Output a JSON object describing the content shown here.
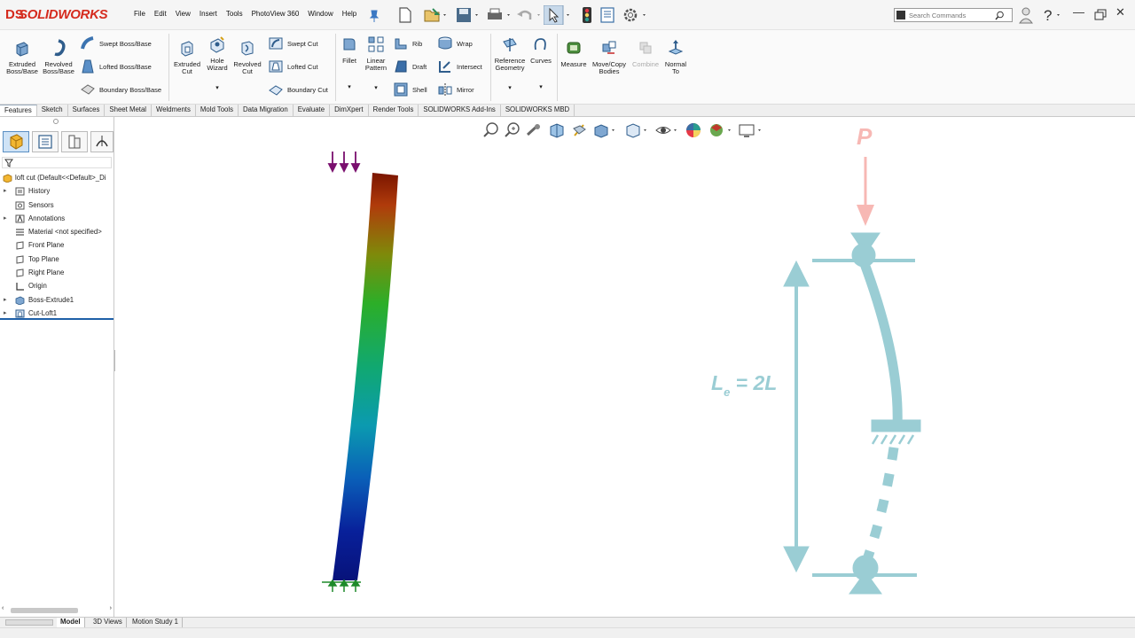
{
  "app": {
    "logo_ds": "DS",
    "logo_name": "SOLIDWORKS",
    "menu": [
      "File",
      "Edit",
      "View",
      "Insert",
      "Tools",
      "PhotoView 360",
      "Window",
      "Help"
    ],
    "search_placeholder": "Search Commands"
  },
  "ribbon": {
    "extruded_boss": "Extruded Boss/Base",
    "revolved_boss": "Revolved Boss/Base",
    "swept_boss": "Swept Boss/Base",
    "lofted_boss": "Lofted Boss/Base",
    "boundary_boss": "Boundary Boss/Base",
    "extruded_cut": "Extruded Cut",
    "hole_wizard": "Hole Wizard",
    "revolved_cut": "Revolved Cut",
    "swept_cut": "Swept Cut",
    "lofted_cut": "Lofted Cut",
    "boundary_cut": "Boundary Cut",
    "fillet": "Fillet",
    "linear_pattern": "Linear Pattern",
    "rib": "Rib",
    "draft": "Draft",
    "shell": "Shell",
    "wrap": "Wrap",
    "intersect": "Intersect",
    "mirror": "Mirror",
    "reference_geometry": "Reference Geometry",
    "curves": "Curves",
    "measure": "Measure",
    "move_copy": "Move/Copy Bodies",
    "combine": "Combine",
    "normal_to": "Normal To"
  },
  "tabs": [
    "Features",
    "Sketch",
    "Surfaces",
    "Sheet Metal",
    "Weldments",
    "Mold Tools",
    "Data Migration",
    "Evaluate",
    "DimXpert",
    "Render Tools",
    "SOLIDWORKS Add-Ins",
    "SOLIDWORKS MBD"
  ],
  "tree": {
    "root": "loft cut  (Default<<Default>_Di",
    "items": [
      "History",
      "Sensors",
      "Annotations",
      "Material <not specified>",
      "Front Plane",
      "Top Plane",
      "Right Plane",
      "Origin",
      "Boss-Extrude1",
      "Cut-Loft1"
    ]
  },
  "diagram": {
    "load_label": "P",
    "le_main": "L",
    "le_sub": "e",
    "le_rest": " = 2L",
    "accent_color": "#9acdd4",
    "load_color": "#f7b8b4"
  },
  "bottom_tabs": [
    "Model",
    "3D Views",
    "Motion Study 1"
  ]
}
